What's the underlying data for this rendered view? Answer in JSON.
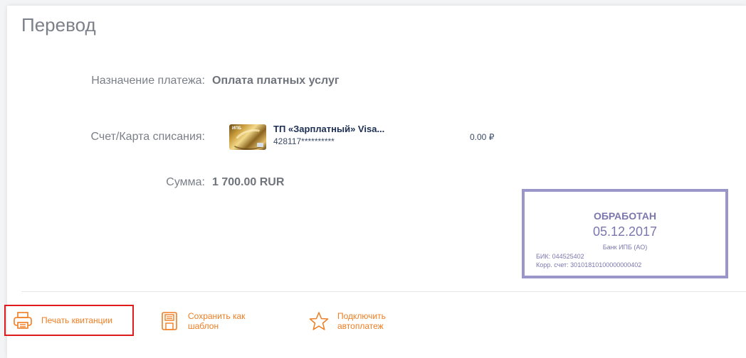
{
  "page": {
    "title": "Перевод"
  },
  "payment": {
    "purpose_label": "Назначение платежа:",
    "purpose_value": "Оплата платных услуг",
    "account_label": "Счет/Карта списания:",
    "card_name": "ТП «Зарплатный» Visa...",
    "card_number": "428117**********",
    "card_balance": "0.00 ₽",
    "amount_label": "Сумма:",
    "amount_value": "1 700.00 RUR"
  },
  "stamp": {
    "status": "ОБРАБОТАН",
    "date": "05.12.2017",
    "bank": "Банк ИПБ (АО)",
    "bik": "БИК: 044525402",
    "corr_account": "Корр. счет: 30101810100000000402",
    "border_color": "#9b96c9"
  },
  "actions": {
    "print_label": "Печать квитанции",
    "save_line1": "Сохранить как",
    "save_line2": "шаблон",
    "auto_line1": "Подключить",
    "auto_line2": "автоплатеж",
    "accent_color": "#ef7d22",
    "icons": [
      "printer-icon",
      "floppy-disk-icon",
      "star-icon"
    ]
  }
}
